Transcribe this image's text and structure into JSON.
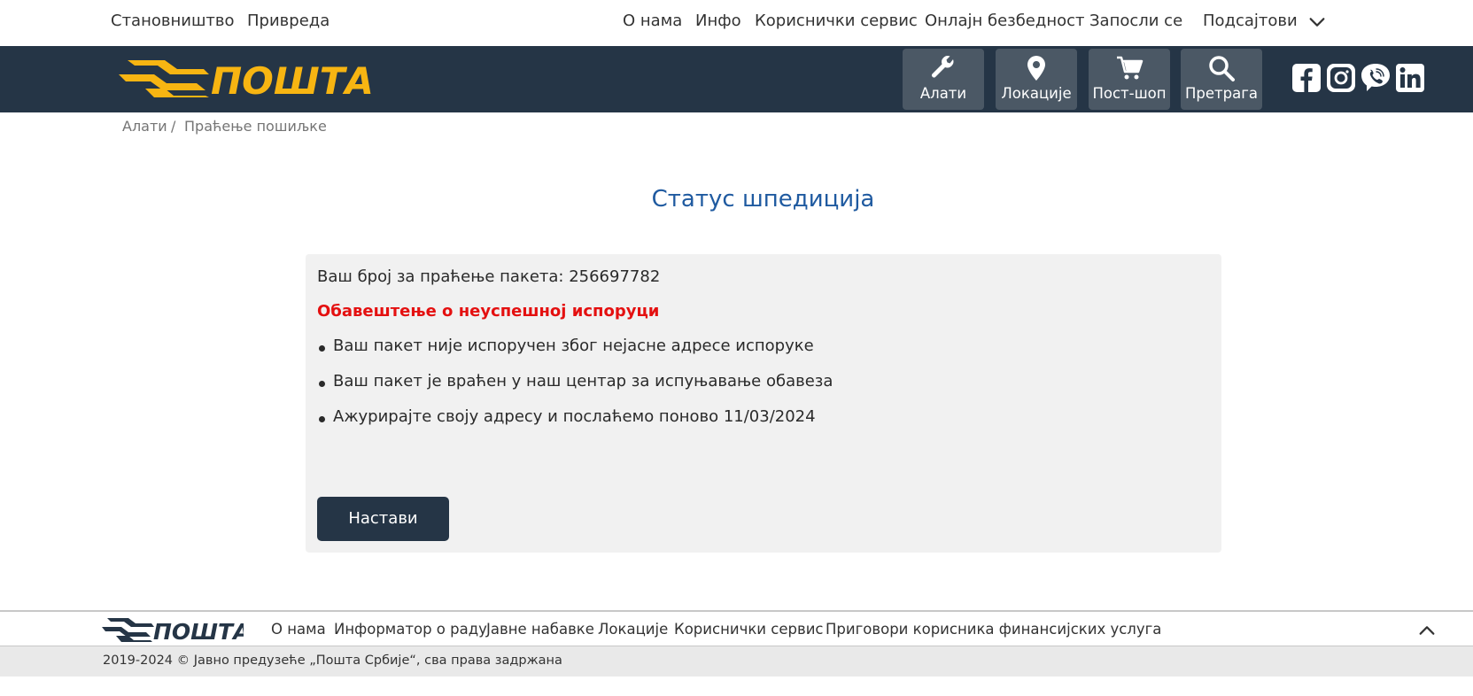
{
  "top_nav": {
    "left": [
      "Становништво",
      "Привреда"
    ],
    "right": [
      "О нама",
      "Инфо",
      "Кориснички сервис",
      "Онлајн безбедност",
      "Запосли се",
      "Подсајтови"
    ]
  },
  "header": {
    "logo_text": "ПОШТА",
    "tools": [
      "Алати",
      "Локације",
      "Пост-шоп",
      "Претрага"
    ],
    "social": [
      "facebook-icon",
      "instagram-icon",
      "viber-icon",
      "linkedin-icon"
    ]
  },
  "breadcrumb": {
    "items": [
      "Алати",
      "Праћење пошиљке"
    ],
    "separator": "/"
  },
  "page": {
    "title": "Статус шпедиција",
    "tracking_line": "Ваш број за праћење пакета: 256697782",
    "alert": "Обавештење о неуспешној испоруци",
    "bullets": [
      "Ваш пакет није испоручен због нејасне адресе испоруке",
      "Ваш пакет је враћен у наш центар за испуњавање обавеза",
      "Ажурирајте своју адресу и послаћемо поново 11/03/2024"
    ],
    "continue_button": "Настави"
  },
  "footer": {
    "logo_text": "ПОШТА",
    "links": [
      "О нама",
      "Информатор о раду",
      "Јавне набавке",
      "Локације",
      "Кориснички сервис",
      "Приговори корисника финансијских услуга"
    ],
    "copyright": "2019-2024 © Јавно предузеће „Пошта Србије“, сва права задржана"
  },
  "colors": {
    "header_bg": "#253546",
    "accent": "#f7b512",
    "title": "#1f5aa0",
    "alert": "#e41010"
  }
}
